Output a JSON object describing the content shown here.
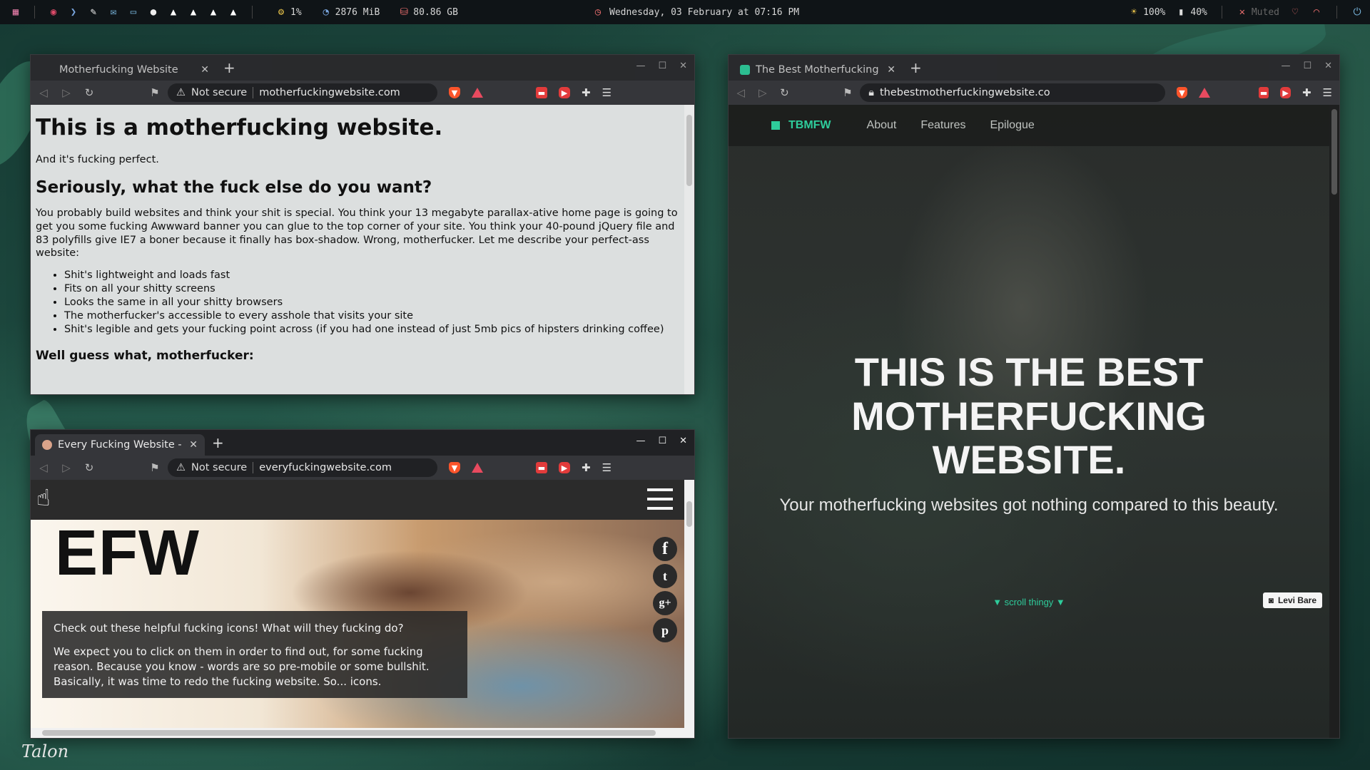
{
  "topbar": {
    "cpu": "1%",
    "memory": "2876 MiB",
    "disk": "80.86 GB",
    "datetime": "Wednesday, 03 February at 07:16 PM",
    "brightness": "100%",
    "battery": "40%",
    "volume": "Muted"
  },
  "window_mfw": {
    "tab_title": "Motherfucking Website",
    "security": "Not secure",
    "url": "motherfuckingwebsite.com",
    "content": {
      "h1": "This is a motherfucking website.",
      "p1": "And it's fucking perfect.",
      "h2": "Seriously, what the fuck else do you want?",
      "p2": "You probably build websites and think your shit is special. You think your 13 megabyte parallax-ative home page is going to get you some fucking Awwward banner you can glue to the top corner of your site. You think your 40-pound jQuery file and 83 polyfills give IE7 a boner because it finally has box-shadow. Wrong, motherfucker. Let me describe your perfect-ass website:",
      "list": [
        "Shit's lightweight and loads fast",
        "Fits on all your shitty screens",
        "Looks the same in all your shitty browsers",
        "The motherfucker's accessible to every asshole that visits your site",
        "Shit's legible and gets your fucking point across (if you had one instead of just 5mb pics of hipsters drinking coffee)"
      ],
      "h3": "Well guess what, motherfucker:"
    }
  },
  "window_efw": {
    "tab_title": "Every Fucking Website - I",
    "security": "Not secure",
    "url": "everyfuckingwebsite.com",
    "logo": "EFW",
    "box_p1": "Check out these helpful fucking icons! What will they fucking do?",
    "box_p2": "We expect you to click on them in order to find out, for some fucking reason. Because you know - words are so pre-mobile or some bullshit. Basically, it was time to redo the fucking website. So... icons.",
    "social": [
      "f",
      "t",
      "g+",
      "p"
    ]
  },
  "window_tbmfw": {
    "tab_title": "The Best Motherfucking W",
    "url": "thebestmotherfuckingwebsite.co",
    "brand": "TBMFW",
    "nav": [
      "About",
      "Features",
      "Epilogue"
    ],
    "hero_title_lines": [
      "THIS IS THE BEST",
      "MOTHERFUCKING",
      "WEBSITE."
    ],
    "hero_sub": "Your motherfucking websites got nothing compared to this beauty.",
    "scroll": "▼ scroll thingy ▼",
    "credit": "Levi Bare"
  },
  "signature": "Talon",
  "colors": {
    "accent_green": "#2ecc9b",
    "topbar_bg": "#0f1417"
  }
}
